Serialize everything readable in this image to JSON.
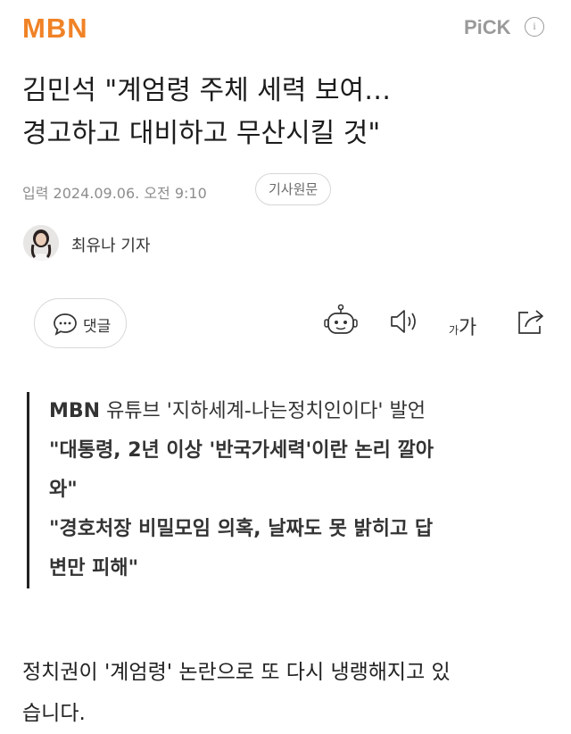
{
  "header": {
    "logo": "MBN",
    "pick_label": "PiCK",
    "info_icon": "info-icon"
  },
  "article": {
    "headline_line1": "김민석 \"계엄령 주체 세력 보여…",
    "headline_line2": "경고하고 대비하고 무산시킬 것\"",
    "meta_label": "입력",
    "date": "2024.09.06. 오전 9:10",
    "original_button": "기사원문",
    "reporter": "최유나 기자"
  },
  "toolbar": {
    "comment_label": "댓글",
    "comment_icon": "speech-bubble-icon",
    "summary_icon": "robot-icon",
    "tts_icon": "speaker-icon",
    "font_small": "가",
    "font_large": "가",
    "share_icon": "share-icon"
  },
  "subheadings": [
    {
      "bold": "MBN",
      "rest": " 유튜브 '지하세계-나는정치인이다' 발언"
    },
    {
      "bold": "\"대통령, 2년 이상 '반국가세력'이란 논리 깔아",
      "rest": ""
    },
    {
      "bold": "와\"",
      "rest": ""
    },
    {
      "bold": "\"경호처장 비밀모임 의혹, 날짜도 못 밝히고 답",
      "rest": ""
    },
    {
      "bold": "변만 피해\"",
      "rest": ""
    }
  ],
  "body": {
    "line1": "정치권이 '계엄령' 논란으로 또 다시 냉랭해지고 있",
    "line2": "습니다."
  },
  "colors": {
    "brand": "#f08226",
    "text": "#1e1e1e",
    "muted": "#8d8d8d"
  }
}
